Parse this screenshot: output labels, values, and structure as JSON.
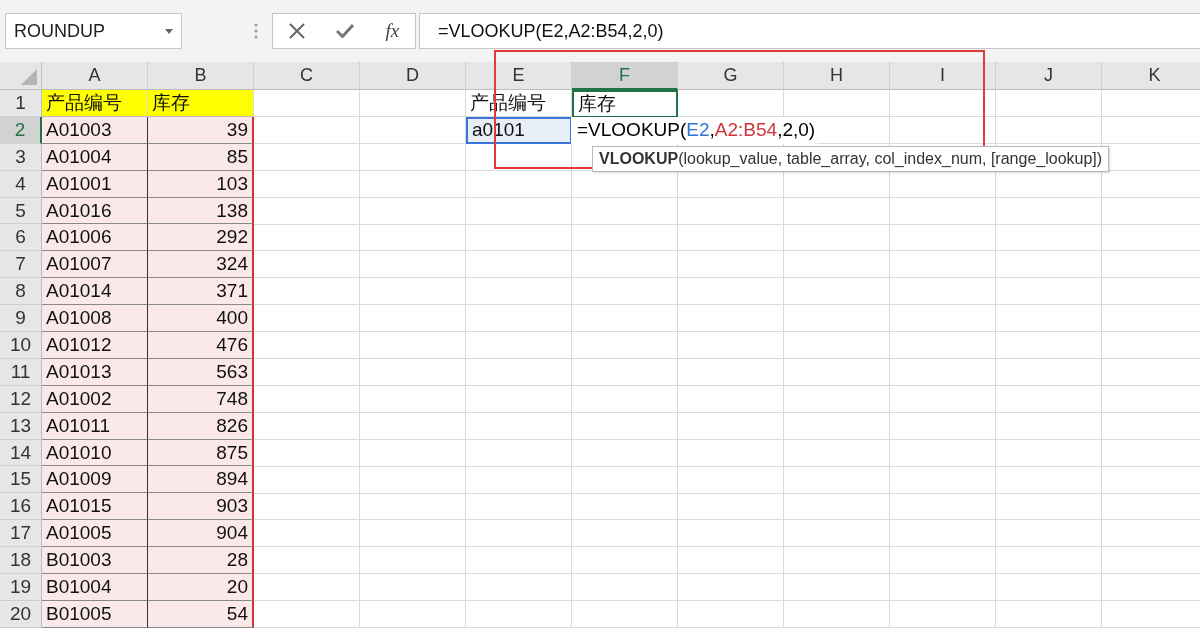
{
  "name_box": {
    "value": "ROUNDUP"
  },
  "formula_bar": {
    "function_label": "fx",
    "value": "=VLOOKUP(E2,A2:B54,2,0)"
  },
  "columns": [
    {
      "label": "A",
      "selected": false
    },
    {
      "label": "B",
      "selected": false
    },
    {
      "label": "C",
      "selected": false
    },
    {
      "label": "D",
      "selected": false
    },
    {
      "label": "E",
      "selected": false
    },
    {
      "label": "F",
      "selected": true
    },
    {
      "label": "G",
      "selected": false
    },
    {
      "label": "H",
      "selected": false
    },
    {
      "label": "I",
      "selected": false
    },
    {
      "label": "J",
      "selected": false
    },
    {
      "label": "K",
      "selected": false
    }
  ],
  "rows": [
    {
      "number": "1",
      "selected": false,
      "kind": "header",
      "a": "产品编号",
      "b": "库存",
      "e": {
        "text": "产品编号"
      },
      "f": {
        "text": "库存",
        "boxed": true
      }
    },
    {
      "number": "2",
      "selected": true,
      "kind": "data",
      "a": "A01003",
      "b": "39",
      "e": {
        "text": "a0101",
        "referenced": true
      },
      "f": {
        "editing": true,
        "parts": [
          {
            "text": "=VLOOKUP(",
            "color": "#000000"
          },
          {
            "text": "E2",
            "color": "#2e75d6"
          },
          {
            "text": ",",
            "color": "#000000"
          },
          {
            "text": "A2:B54",
            "color": "#d0343c"
          },
          {
            "text": ",2,0)",
            "color": "#000000"
          }
        ]
      }
    },
    {
      "number": "3",
      "selected": false,
      "kind": "data",
      "a": "A01004",
      "b": "85"
    },
    {
      "number": "4",
      "selected": false,
      "kind": "data",
      "a": "A01001",
      "b": "103"
    },
    {
      "number": "5",
      "selected": false,
      "kind": "data",
      "a": "A01016",
      "b": "138"
    },
    {
      "number": "6",
      "selected": false,
      "kind": "data",
      "a": "A01006",
      "b": "292"
    },
    {
      "number": "7",
      "selected": false,
      "kind": "data",
      "a": "A01007",
      "b": "324"
    },
    {
      "number": "8",
      "selected": false,
      "kind": "data",
      "a": "A01014",
      "b": "371"
    },
    {
      "number": "9",
      "selected": false,
      "kind": "data",
      "a": "A01008",
      "b": "400"
    },
    {
      "number": "10",
      "selected": false,
      "kind": "data",
      "a": "A01012",
      "b": "476"
    },
    {
      "number": "11",
      "selected": false,
      "kind": "data",
      "a": "A01013",
      "b": "563"
    },
    {
      "number": "12",
      "selected": false,
      "kind": "data",
      "a": "A01002",
      "b": "748"
    },
    {
      "number": "13",
      "selected": false,
      "kind": "data",
      "a": "A01011",
      "b": "826"
    },
    {
      "number": "14",
      "selected": false,
      "kind": "data",
      "a": "A01010",
      "b": "875"
    },
    {
      "number": "15",
      "selected": false,
      "kind": "data",
      "a": "A01009",
      "b": "894"
    },
    {
      "number": "16",
      "selected": false,
      "kind": "data",
      "a": "A01015",
      "b": "903"
    },
    {
      "number": "17",
      "selected": false,
      "kind": "data",
      "a": "A01005",
      "b": "904"
    },
    {
      "number": "18",
      "selected": false,
      "kind": "data",
      "a": "B01003",
      "b": "28"
    },
    {
      "number": "19",
      "selected": false,
      "kind": "data",
      "a": "B01004",
      "b": "20"
    },
    {
      "number": "20",
      "selected": false,
      "kind": "data",
      "a": "B01005",
      "b": "54"
    }
  ],
  "tooltip": "**VLOOKUP**(lookup_value, table_array, col_index_num, [range_lookup])"
}
